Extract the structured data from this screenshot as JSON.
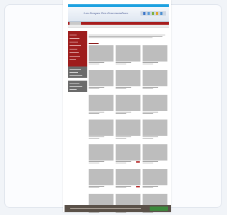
{
  "site": {
    "logo_text": "Les Soupes Des Gourmandises",
    "topbar_text": "",
    "nav_tab": "",
    "heading": "",
    "cookie_button": ""
  },
  "colors": {
    "accent_red": "#a71c1c",
    "top_blue": "#1da1e0",
    "sidebar_gray": "#6b6b6b",
    "cookie_green": "#3c8a3c"
  },
  "grid": {
    "rows": 7,
    "columns": 3
  }
}
